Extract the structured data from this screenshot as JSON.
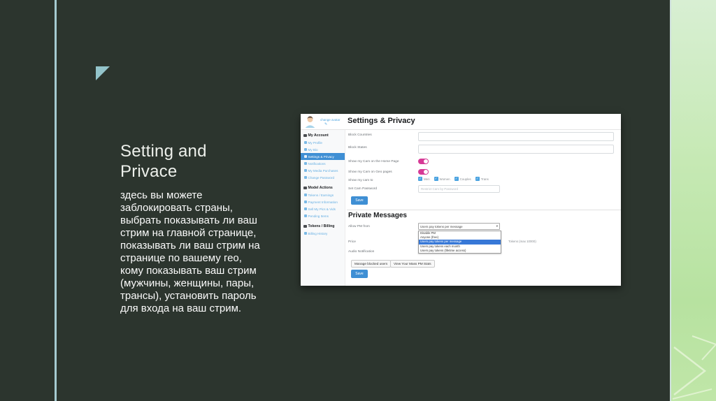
{
  "slide": {
    "title_lines": [
      "Setting and",
      "Privace"
    ],
    "body": "здесь вы можете заблокировать страны, выбрать показывать ли ваш стрим на главной странице, показывать ли ваш стрим на странице по вашему гео, кому показывать ваш стрим (мужчины, женщины, пары, трансы), установить пароль для входа на ваш стрим."
  },
  "screenshot": {
    "header": {
      "change_avatar_label": "change avatar",
      "title": "Settings & Privacy"
    },
    "sidebar": {
      "sections": [
        {
          "label": "My Account",
          "items": [
            {
              "label": "My Profile"
            },
            {
              "label": "My Bio"
            },
            {
              "label": "Settings & Privacy",
              "active": true
            },
            {
              "label": "Notifications"
            },
            {
              "label": "My Media Purchases"
            },
            {
              "label": "Change Password"
            }
          ]
        },
        {
          "label": "Model Actions",
          "items": [
            {
              "label": "Tokens / Earnings"
            },
            {
              "label": "Payment Information"
            },
            {
              "label": "Sell My Pics & Vids"
            },
            {
              "label": "Pending Items"
            }
          ]
        },
        {
          "label": "Tokens / Billing",
          "items": [
            {
              "label": "Billing History"
            }
          ]
        }
      ]
    },
    "settings": {
      "block_countries_label": "Block Countries",
      "block_states_label": "Block States",
      "show_home_label": "Show my Cam on the Home Page",
      "show_home_on": true,
      "show_geo_label": "Show my Cam on Geo pages",
      "show_geo_on": true,
      "show_cam_to_label": "Show my cam to",
      "audiences": [
        "Men",
        "Women",
        "Couples",
        "Trans"
      ],
      "set_cam_password_label": "Set Cam Password",
      "cam_password_placeholder": "Restrict Cam by Password",
      "save_label": "Save"
    },
    "private_messages": {
      "heading": "Private Messages",
      "allow_pm_label": "Allow PM from",
      "selected_option": "Users pay tokens per message",
      "options": [
        "Disable PM",
        "Anyone (free)",
        "Users pay tokens per message",
        "Users pay tokens each month",
        "Users pay tokens (lifetime access)"
      ],
      "highlighted_option_index": 2,
      "price_label": "Price",
      "tokens_hint": "Tokens (max 10000)",
      "audio_label": "Audio Notification",
      "manage_blocked_label": "Manage blocked users",
      "view_stats_label": "View Your Mass PM Stats",
      "save_label": "Save"
    }
  },
  "colors": {
    "slide_background": "#2c352e",
    "accent_line": "#a5cbd0",
    "triangle": "#93c4ca",
    "strip_green_top": "#d8efd3",
    "strip_green_bottom": "#b7e2a0",
    "primary_button": "#3f8fd4",
    "sidebar_active": "#3f8fd4",
    "toggle_on": "#d63a96",
    "checkbox_blue": "#49a2e0",
    "dropdown_highlight": "#3778d7"
  }
}
